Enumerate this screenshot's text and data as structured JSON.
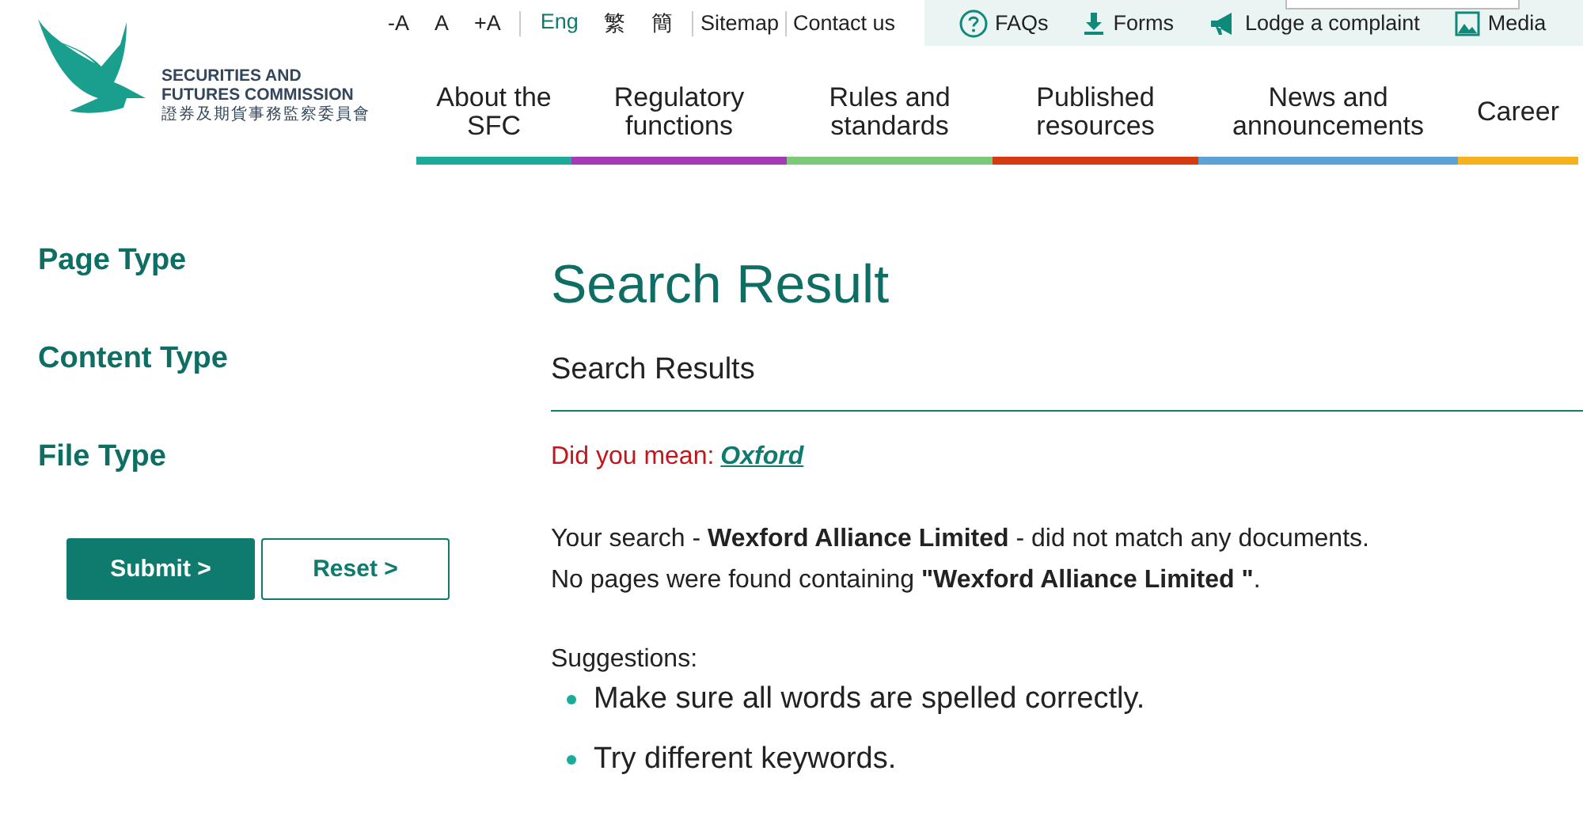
{
  "logo": {
    "line_1": "SECURITIES AND",
    "line_2": "FUTURES COMMISSION",
    "line_3": "證券及期貨事務監察委員會"
  },
  "font_size_links": [
    "-A",
    "A",
    "+A"
  ],
  "languages": [
    {
      "label": "Eng",
      "selected": true
    },
    {
      "label": "繁",
      "selected": false
    },
    {
      "label": "簡",
      "selected": false
    }
  ],
  "top_links": [
    "Sitemap",
    "Contact us"
  ],
  "quick_links": [
    {
      "label": "FAQs",
      "kind": "question"
    },
    {
      "label": "Forms",
      "kind": "download"
    },
    {
      "label": "Lodge a complaint",
      "kind": "megaphone"
    },
    {
      "label": "Media",
      "kind": "image"
    }
  ],
  "nav": [
    {
      "label": "About the SFC",
      "color": "#1aab9b"
    },
    {
      "label": "Regulatory functions",
      "color": "#a53ab5"
    },
    {
      "label": "Rules and standards",
      "color": "#7dc97a"
    },
    {
      "label": "Published resources",
      "color": "#d63a10"
    },
    {
      "label": "News and announcements",
      "color": "#5aa3d4"
    },
    {
      "label": "Career",
      "color": "#f5b21e"
    }
  ],
  "filters": [
    "Page Type",
    "Content Type",
    "File Type"
  ],
  "buttons": {
    "submit": "Submit >",
    "reset": "Reset >"
  },
  "title": "Search Result",
  "section_title": "Search Results",
  "did_you_mean": {
    "label": "Did you mean:",
    "link": "Oxford"
  },
  "messages": [
    "Your search - **Wexford Alliance Limited** - did not match any documents.",
    "No pages were found containing **\"Wexford Alliance Limited \"**."
  ],
  "suggestions_label": "Suggestions:",
  "suggestions": [
    "Make sure all words are spelled correctly.",
    "Try different keywords."
  ]
}
